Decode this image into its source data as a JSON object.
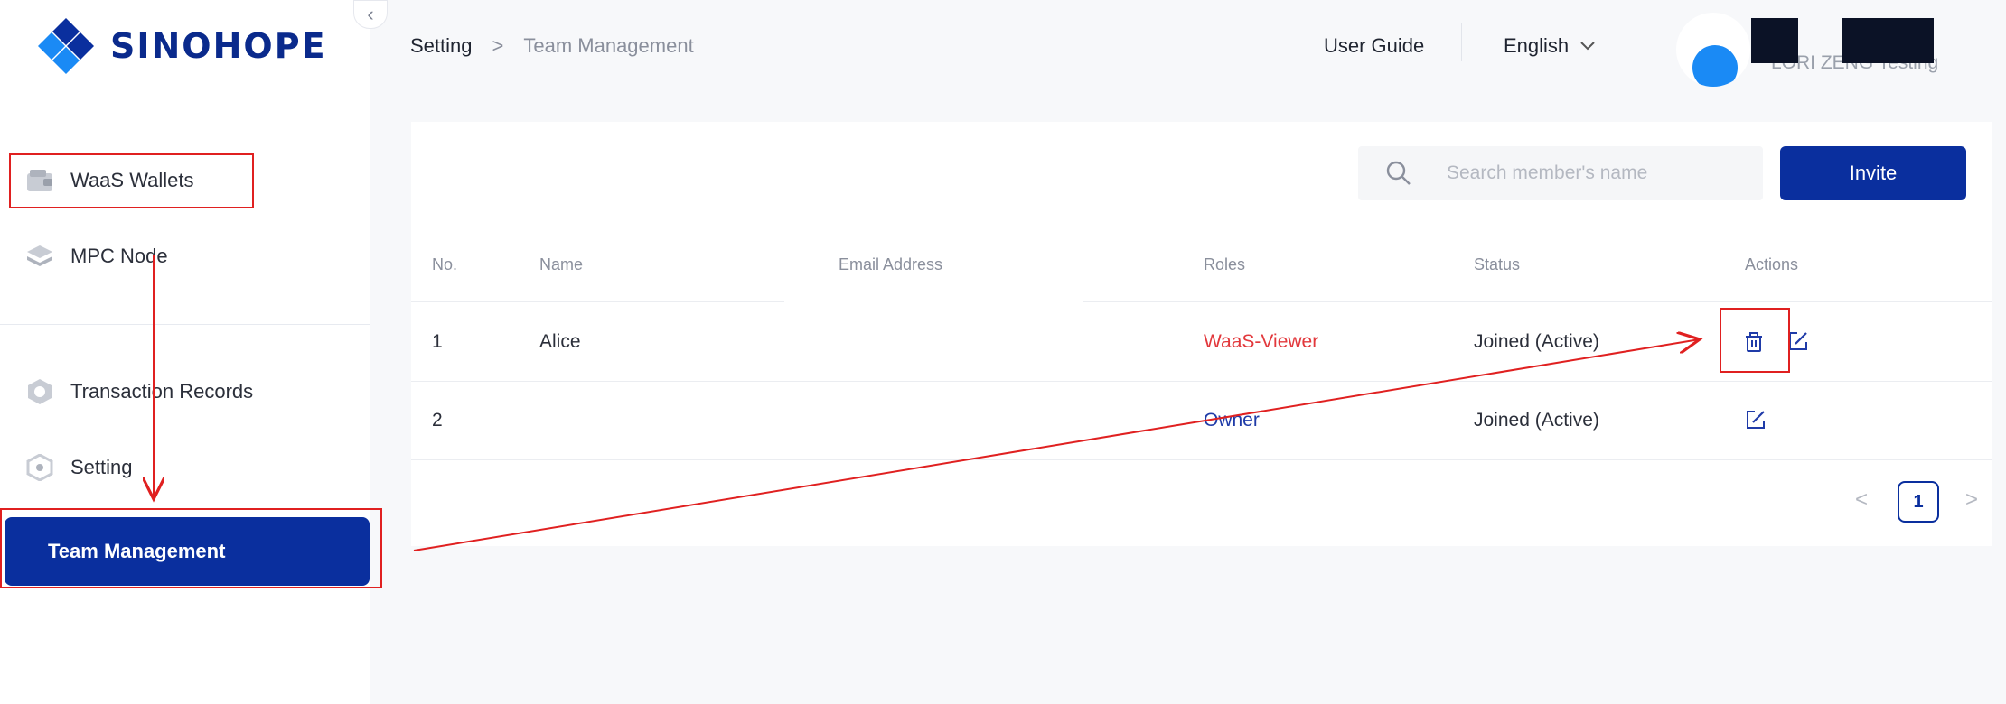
{
  "brand": {
    "name": "SINOHOPE",
    "accent": "#0a2f9e"
  },
  "sidebar": {
    "items": [
      {
        "label": "WaaS Wallets",
        "icon": "wallet-icon"
      },
      {
        "label": "MPC Node",
        "icon": "layers-icon"
      },
      {
        "label": "Transaction Records",
        "icon": "transaction-icon"
      },
      {
        "label": "Setting",
        "icon": "settings-hex-icon"
      },
      {
        "label": "Team Management",
        "active": true
      }
    ]
  },
  "header": {
    "breadcrumb": {
      "home": "Setting",
      "separator": ">",
      "current": "Team Management"
    },
    "user_guide": "User Guide",
    "language": "English",
    "user_name": "LORI ZENG Testing"
  },
  "toolbar": {
    "search_placeholder": "Search member's name",
    "invite_label": "Invite"
  },
  "table": {
    "columns": [
      "No.",
      "Name",
      "Email Address",
      "Roles",
      "Status",
      "Actions"
    ],
    "rows": [
      {
        "no": "1",
        "name": "Alice",
        "email": "",
        "role": "WaaS-Viewer",
        "status": "Joined (Active)",
        "actions": [
          "delete",
          "edit"
        ]
      },
      {
        "no": "2",
        "name": "",
        "email": "",
        "role": "Owner",
        "status": "Joined (Active)",
        "actions": [
          "edit"
        ]
      }
    ]
  },
  "pagination": {
    "current_page": "1",
    "prev": "<",
    "next": ">"
  },
  "colors": {
    "annotation": "#e02020",
    "viewer_role": "#e2383c",
    "owner_role": "#1f3ba8"
  }
}
